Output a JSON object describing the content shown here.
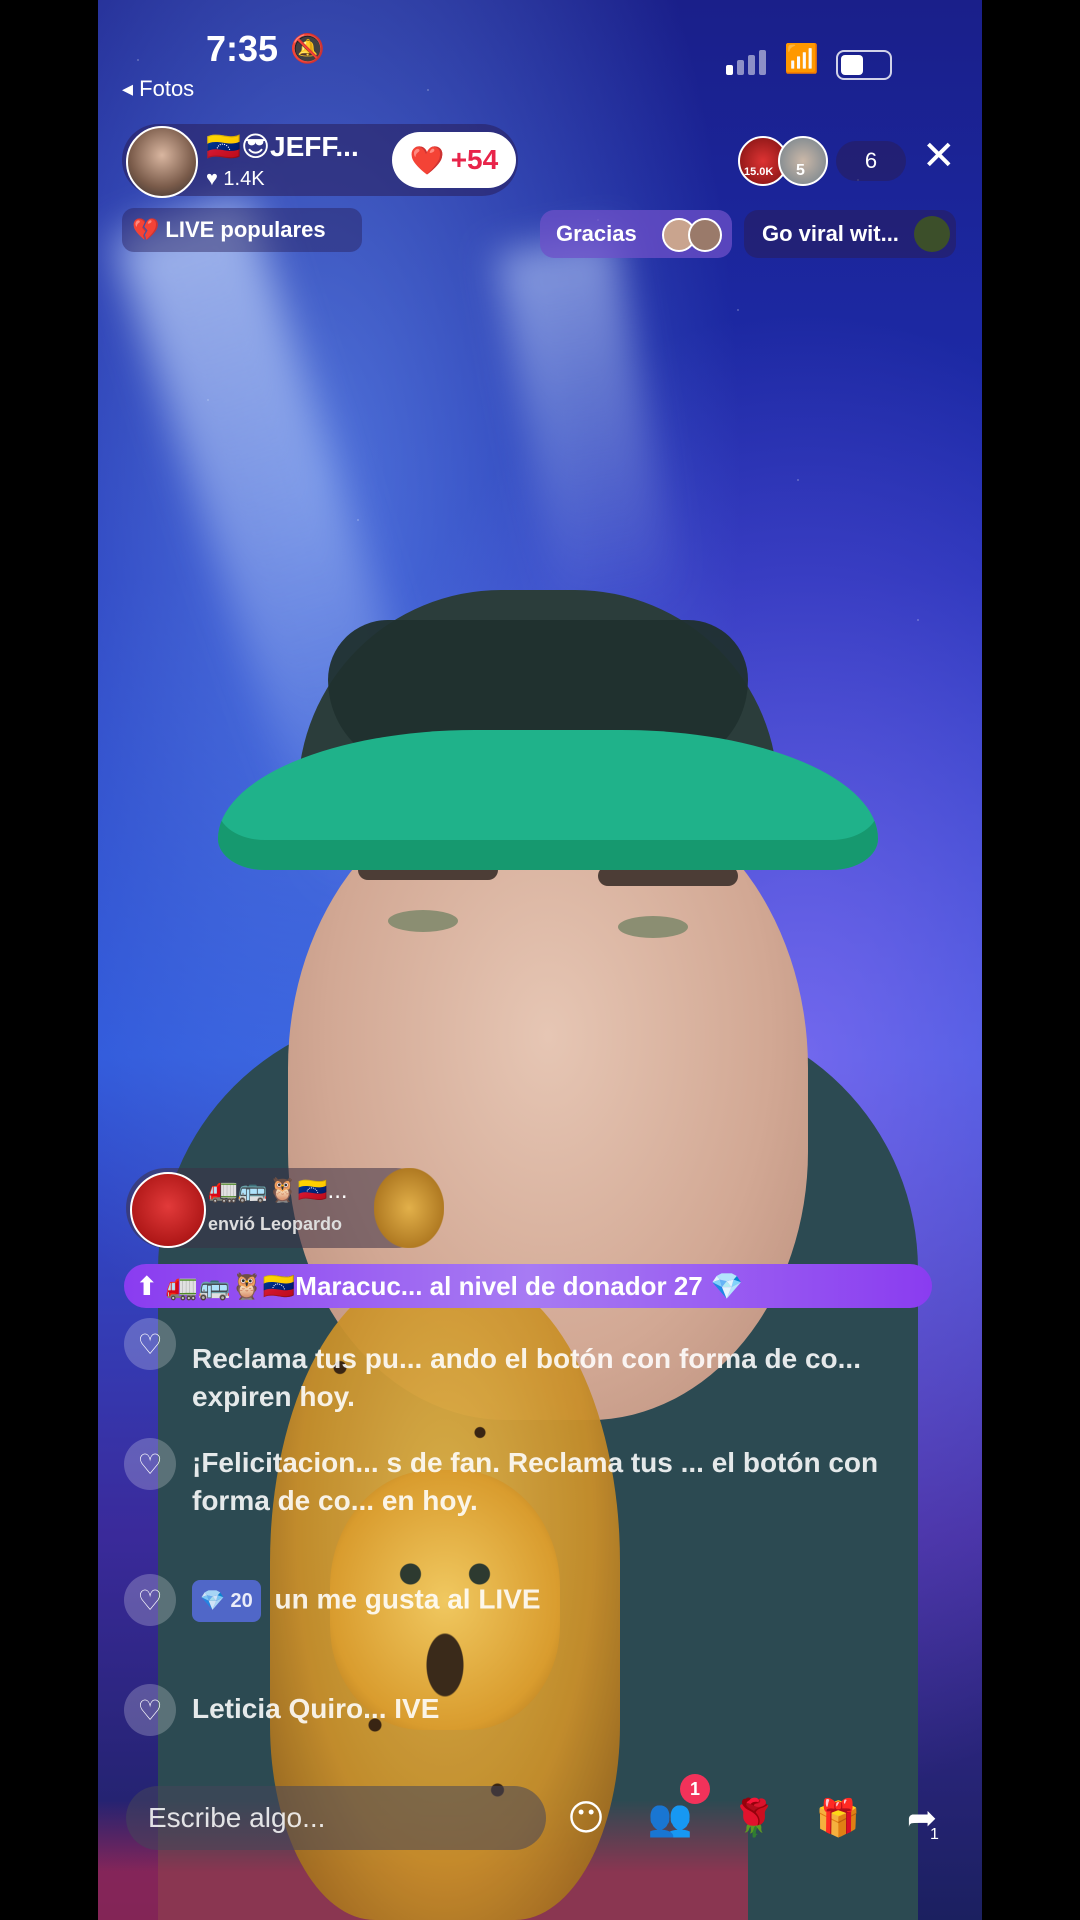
{
  "status_bar": {
    "time": "7:35",
    "back_label": "◂ Fotos"
  },
  "host": {
    "name": "🇻🇪😎JEFF...",
    "likes": "♥ 1.4K",
    "like_button": "+54"
  },
  "viewers": {
    "avatar_badges": [
      "15.0K",
      "5"
    ],
    "count": "6"
  },
  "popular": {
    "label": "LIVE populares"
  },
  "gracias": {
    "label": "Gracias"
  },
  "viral": {
    "label": "Go viral wit..."
  },
  "gift_notice": {
    "emojis": "🚛🚌🦉🇻🇪...",
    "text": "envió Leopardo"
  },
  "donor_banner": {
    "text": "🚛🚌🦉🇻🇪Maracuc... al nivel de donador 27"
  },
  "chat": [
    {
      "text": "Reclama tus pu... ando el botón con forma de co... expiren hoy."
    },
    {
      "text": "¡Felicitacion... s de fan. Reclama tus ... el botón con forma de co... en hoy."
    },
    {
      "badge": "20",
      "text": "un me gusta al LIVE"
    },
    {
      "text": "Leticia Quiro... IVE"
    }
  ],
  "bottom_bar": {
    "input_placeholder": "Escribe algo...",
    "notif_count": "1",
    "share_count": "1"
  },
  "icons": {
    "bell": "bell-slash-icon",
    "close": "close-icon",
    "emoji": "emoji-icon",
    "people": "people-icon",
    "rose": "rose-icon",
    "gift": "gift-icon",
    "share": "share-icon"
  },
  "colors": {
    "like_red": "#e8244a",
    "donor_purple": "#8a3cf0",
    "notif_pink": "#f2325a"
  }
}
